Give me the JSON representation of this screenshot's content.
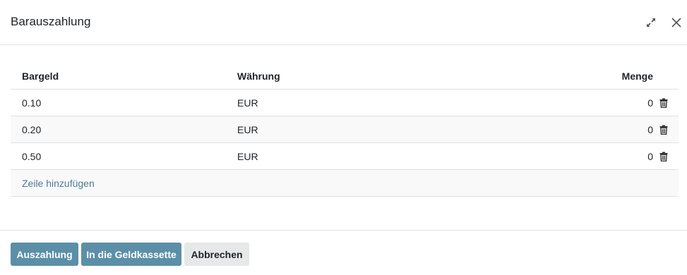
{
  "dialog": {
    "title": "Barauszahlung",
    "expand_icon": "expand-arrows-icon",
    "close_icon": "close-icon"
  },
  "table": {
    "columns": {
      "bargeld": "Bargeld",
      "wahrung": "Währung",
      "menge": "Menge"
    },
    "rows": [
      {
        "bargeld": "0.10",
        "wahrung": "EUR",
        "menge": "0"
      },
      {
        "bargeld": "0.20",
        "wahrung": "EUR",
        "menge": "0"
      },
      {
        "bargeld": "0.50",
        "wahrung": "EUR",
        "menge": "0"
      }
    ],
    "add_row_label": "Zeile hinzufügen",
    "delete_icon": "trash-icon"
  },
  "footer": {
    "auszahlung_label": "Auszahlung",
    "kassette_label": "In die Geldkassette",
    "abbrechen_label": "Abbrechen"
  },
  "colors": {
    "primary": "#5b8fa8",
    "link": "#4b7b93",
    "secondary": "#e6e8ea",
    "border": "#dee2e6"
  }
}
